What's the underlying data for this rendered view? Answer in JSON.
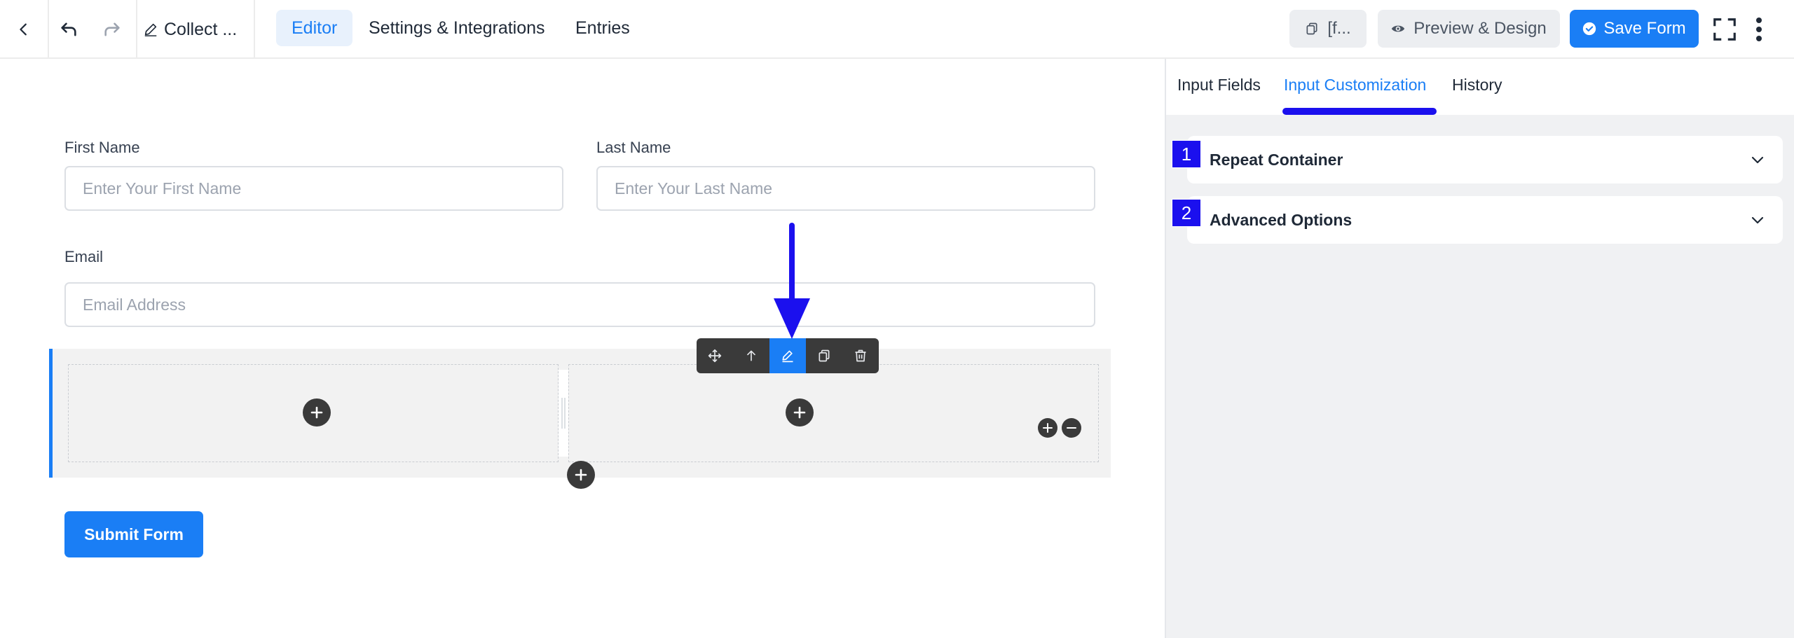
{
  "topbar": {
    "form_title": "Collect ...",
    "tabs": [
      {
        "label": "Editor",
        "active": true
      },
      {
        "label": "Settings & Integrations",
        "active": false
      },
      {
        "label": "Entries",
        "active": false
      }
    ],
    "shortcode_label": "[f...",
    "preview_label": "Preview & Design",
    "save_label": "Save Form"
  },
  "form": {
    "first_name": {
      "label": "First Name",
      "placeholder": "Enter Your First Name"
    },
    "last_name": {
      "label": "Last Name",
      "placeholder": "Enter Your Last Name"
    },
    "email": {
      "label": "Email",
      "placeholder": "Email Address"
    },
    "submit_label": "Submit Form"
  },
  "panel": {
    "tabs": [
      {
        "label": "Input Fields",
        "active": false
      },
      {
        "label": "Input Customization",
        "active": true
      },
      {
        "label": "History",
        "active": false
      }
    ],
    "sections": [
      {
        "badge": "1",
        "title": "Repeat Container"
      },
      {
        "badge": "2",
        "title": "Advanced Options"
      }
    ]
  },
  "colors": {
    "accent": "#1a7ef5",
    "annotation": "#1b10ee",
    "toolbar_bg": "#3a3a3a",
    "panel_bg": "#f0f1f3"
  },
  "icons": {
    "back": "chevron-left-icon",
    "undo": "undo-icon",
    "redo": "redo-icon",
    "title_edit": "pencil-icon",
    "shortcode": "copy-icon",
    "preview": "eye-icon",
    "save": "check-circle-icon",
    "fullscreen": "fullscreen-icon",
    "more": "more-vertical-icon",
    "toolbar": [
      "move-icon",
      "arrow-up-icon",
      "edit-icon",
      "duplicate-icon",
      "trash-icon"
    ]
  }
}
